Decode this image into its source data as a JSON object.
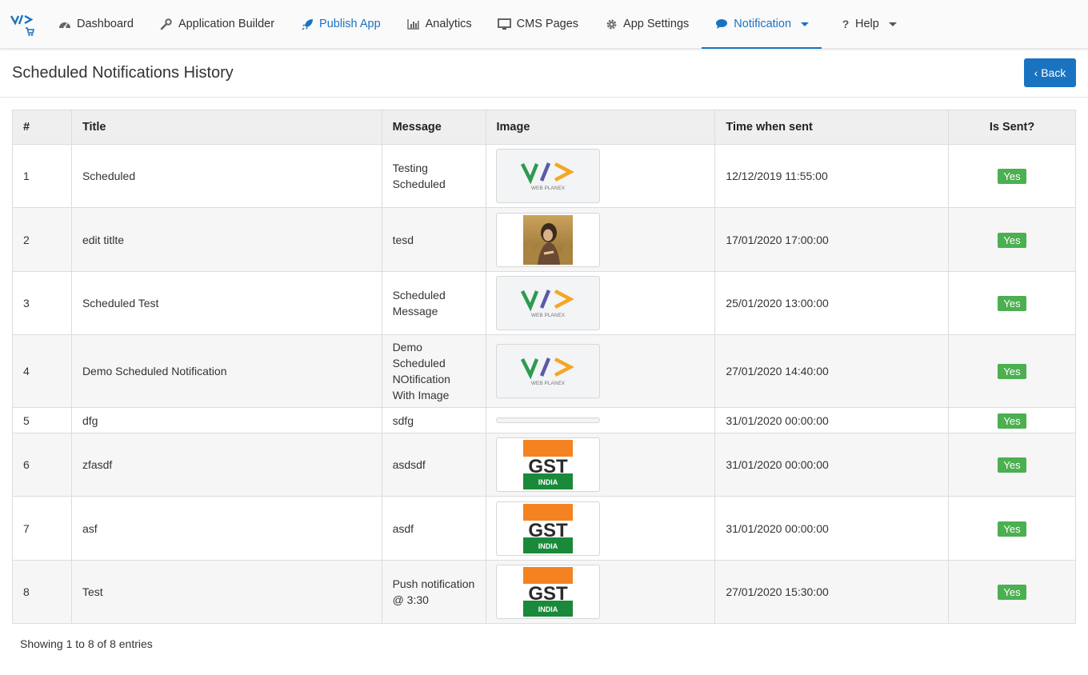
{
  "nav": {
    "items": [
      {
        "key": "dashboard",
        "label": "Dashboard",
        "icon": "dashboard-icon"
      },
      {
        "key": "builder",
        "label": "Application Builder",
        "icon": "wrench-icon"
      },
      {
        "key": "publish",
        "label": "Publish App",
        "icon": "rocket-icon"
      },
      {
        "key": "analytics",
        "label": "Analytics",
        "icon": "bar-chart-icon"
      },
      {
        "key": "cms",
        "label": "CMS Pages",
        "icon": "monitor-icon"
      },
      {
        "key": "settings",
        "label": "App Settings",
        "icon": "gear-icon"
      },
      {
        "key": "notification",
        "label": "Notification",
        "icon": "chat-icon"
      },
      {
        "key": "help",
        "label": "Help",
        "icon": "question-icon"
      }
    ]
  },
  "page": {
    "title": "Scheduled Notifications History",
    "back_label": "‹ Back"
  },
  "table": {
    "headers": {
      "num": "#",
      "title": "Title",
      "message": "Message",
      "image": "Image",
      "time": "Time when sent",
      "sent": "Is Sent?"
    },
    "rows": [
      {
        "num": "1",
        "title": "Scheduled",
        "message": "Testing Scheduled",
        "image": "webplanex-logo",
        "time": "12/12/2019 11:55:00",
        "sent": "Yes"
      },
      {
        "num": "2",
        "title": "edit titlte",
        "message": "tesd",
        "image": "photo-girl-field",
        "time": "17/01/2020 17:00:00",
        "sent": "Yes"
      },
      {
        "num": "3",
        "title": "Scheduled Test",
        "message": "Scheduled Message",
        "image": "webplanex-logo",
        "time": "25/01/2020 13:00:00",
        "sent": "Yes"
      },
      {
        "num": "4",
        "title": "Demo Scheduled Notification",
        "message": "Demo Scheduled NOtification With Image",
        "image": "webplanex-logo",
        "time": "27/01/2020 14:40:00",
        "sent": "Yes"
      },
      {
        "num": "5",
        "title": "dfg",
        "message": "sdfg",
        "image": "empty",
        "time": "31/01/2020 00:00:00",
        "sent": "Yes"
      },
      {
        "num": "6",
        "title": "zfasdf",
        "message": "asdsdf",
        "image": "gst-india",
        "time": "31/01/2020 00:00:00",
        "sent": "Yes"
      },
      {
        "num": "7",
        "title": "asf",
        "message": "asdf",
        "image": "gst-india",
        "time": "31/01/2020 00:00:00",
        "sent": "Yes"
      },
      {
        "num": "8",
        "title": "Test",
        "message": "Push notification @ 3:30",
        "image": "gst-india",
        "time": "27/01/2020 15:30:00",
        "sent": "Yes"
      }
    ]
  },
  "footer": {
    "info": "Showing 1 to 8 of 8 entries"
  },
  "logo_text": {
    "webplanex": "WEB PLANEX",
    "gst": "GST",
    "india": "INDIA"
  },
  "colors": {
    "accent": "#1a73c0",
    "badge": "#4caf50"
  }
}
